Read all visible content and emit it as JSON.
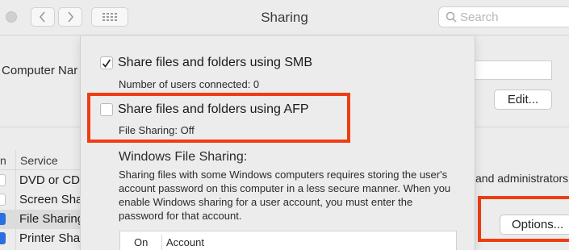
{
  "window": {
    "title": "Sharing"
  },
  "toolbar": {
    "search_placeholder": "Search"
  },
  "background": {
    "computer_name_label": "Computer Nar",
    "edit_button": "Edit...",
    "service_header_on": "n",
    "service_header_service": "Service",
    "services": [
      {
        "label": "DVD or CD",
        "checked": false,
        "selected": false
      },
      {
        "label": "Screen Sha",
        "checked": false,
        "selected": false
      },
      {
        "label": "File Sharing",
        "checked": true,
        "selected": true
      },
      {
        "label": "Printer Sha",
        "checked": true,
        "selected": false
      }
    ],
    "admins_text": "and administrators",
    "options_button": "Options..."
  },
  "sheet": {
    "smb": {
      "label": "Share files and folders using SMB",
      "checked": true,
      "sub": "Number of users connected: 0"
    },
    "afp": {
      "label": "Share files and folders using AFP",
      "checked": false,
      "sub": "File Sharing: Off"
    },
    "windows_sharing": {
      "title": "Windows File Sharing:",
      "description": "Sharing files with some Windows computers requires storing the user's account password on this computer in a less secure manner. When you enable Windows sharing for a user account, you must enter the password for that account."
    },
    "accounts_table": {
      "col_on": "On",
      "col_account": "Account"
    }
  },
  "colors": {
    "highlight_box": "#ef3d13",
    "accent": "#2a6fe0"
  }
}
